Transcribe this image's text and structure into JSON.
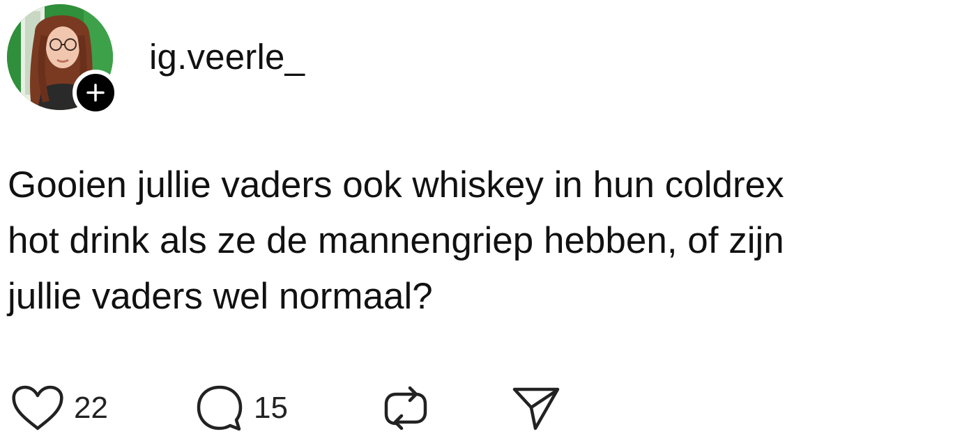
{
  "post": {
    "username": "ig.veerle_",
    "text_lines": [
      "Gooien jullie vaders ook whiskey in hun coldrex",
      "hot drink als ze de mannengriep hebben, of zijn",
      "jullie vaders wel normaal?"
    ],
    "actions": {
      "likes": "22",
      "comments": "15"
    }
  },
  "icons": {
    "follow": "plus-icon",
    "like": "heart-icon",
    "comment": "speech-bubble-icon",
    "repost": "repost-arrows-icon",
    "share": "paper-plane-icon"
  },
  "colors": {
    "text": "#111111",
    "badge": "#000000",
    "avatar_background": "#2f8f3a"
  }
}
